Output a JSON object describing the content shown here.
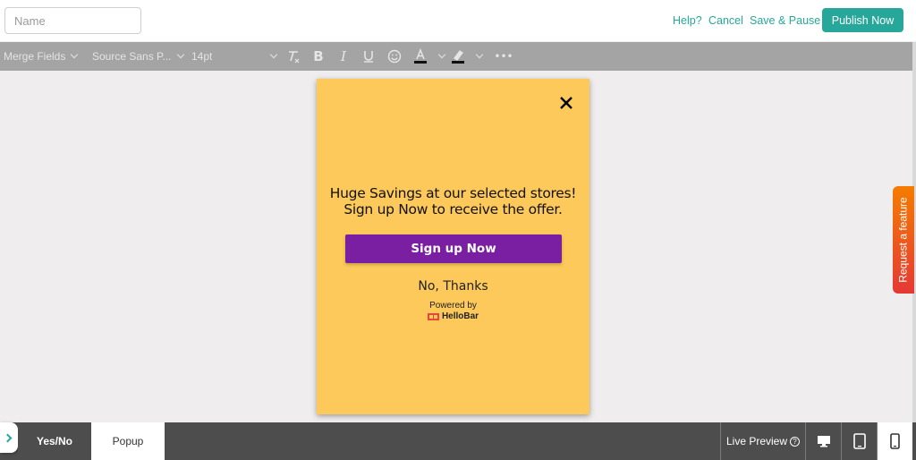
{
  "header": {
    "name_placeholder": "Name",
    "name_value": "",
    "help_label": "Help?",
    "cancel_label": "Cancel",
    "save_pause_label": "Save & Pause",
    "publish_label": "Publish Now"
  },
  "toolbar": {
    "merge_fields_label": "Merge Fields",
    "font_family_label": "Source Sans P...",
    "font_size_label": "14pt",
    "icons": [
      "clear-format-icon",
      "bold-icon",
      "italic-icon",
      "underline-icon",
      "emoji-icon",
      "text-color-icon",
      "highlight-color-icon",
      "more-icon"
    ]
  },
  "popup": {
    "headline": "Huge Savings at our selected stores!\nSign up Now to receive the offer.",
    "cta_label": "Sign up Now",
    "decline_label": "No, Thanks",
    "powered_by_label": "Powered by",
    "brand_label": "HelloBar",
    "colors": {
      "background": "#fcc95a",
      "cta": "#7b1fa2"
    }
  },
  "feature_tab_label": "Request a feature",
  "bottom": {
    "tab_yesno_label": "Yes/No",
    "tab_popup_label": "Popup",
    "live_preview_label": "Live Preview",
    "active_device": "mobile"
  },
  "colors": {
    "accent": "#27a79a"
  }
}
